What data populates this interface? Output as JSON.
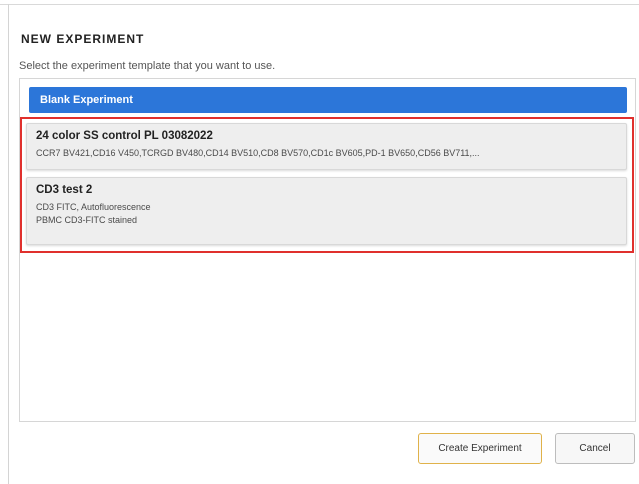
{
  "dialog": {
    "title": "NEW EXPERIMENT",
    "instruction": "Select the experiment template that you want to use."
  },
  "templates": {
    "blank": {
      "label": "Blank Experiment"
    },
    "items": [
      {
        "title": "24 color SS control PL 03082022",
        "lines": [
          "CCR7 BV421,CD16 V450,TCRGD BV480,CD14 BV510,CD8 BV570,CD1c BV605,PD-1 BV650,CD56 BV711,..."
        ]
      },
      {
        "title": "CD3 test 2",
        "lines": [
          "CD3 FITC, Autofluorescence",
          "PBMC CD3-FITC stained"
        ]
      }
    ]
  },
  "buttons": {
    "create": "Create Experiment",
    "cancel": "Cancel"
  },
  "colors": {
    "selected_blue": "#2c76d9",
    "highlight_red": "#e0302d",
    "primary_button_border": "#e0b24a"
  }
}
